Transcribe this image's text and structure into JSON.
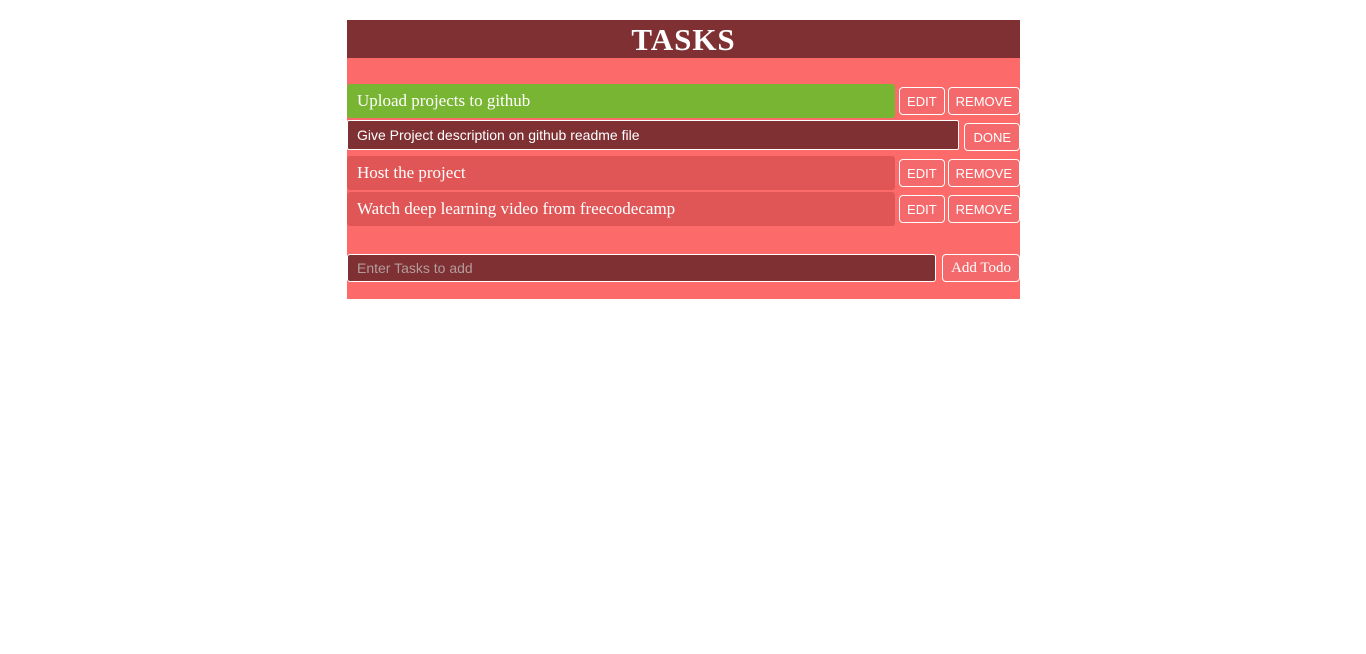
{
  "header": {
    "title": "TASKS"
  },
  "colors": {
    "header_bg": "#7E3033",
    "body_bg": "#FC6A6A",
    "row_bg": "#E05656",
    "completed_bg": "#78B533",
    "button_bg": "#F4696B",
    "text": "#FFFFFF",
    "placeholder": "#B49C9C"
  },
  "todos": [
    {
      "text": "Upload projects to github",
      "state": "completed",
      "editing": false,
      "buttons": {
        "edit": "EDIT",
        "remove": "REMOVE"
      }
    },
    {
      "text": "Give Project description on github readme file",
      "state": "active",
      "editing": true,
      "buttons": {
        "done": "DONE"
      }
    },
    {
      "text": "Host the project",
      "state": "active",
      "editing": false,
      "buttons": {
        "edit": "EDIT",
        "remove": "REMOVE"
      }
    },
    {
      "text": "Watch deep learning video from freecodecamp",
      "state": "active",
      "editing": false,
      "buttons": {
        "edit": "EDIT",
        "remove": "REMOVE"
      }
    }
  ],
  "add_form": {
    "input_value": "",
    "placeholder": "Enter Tasks to add",
    "submit_label": "Add Todo"
  }
}
